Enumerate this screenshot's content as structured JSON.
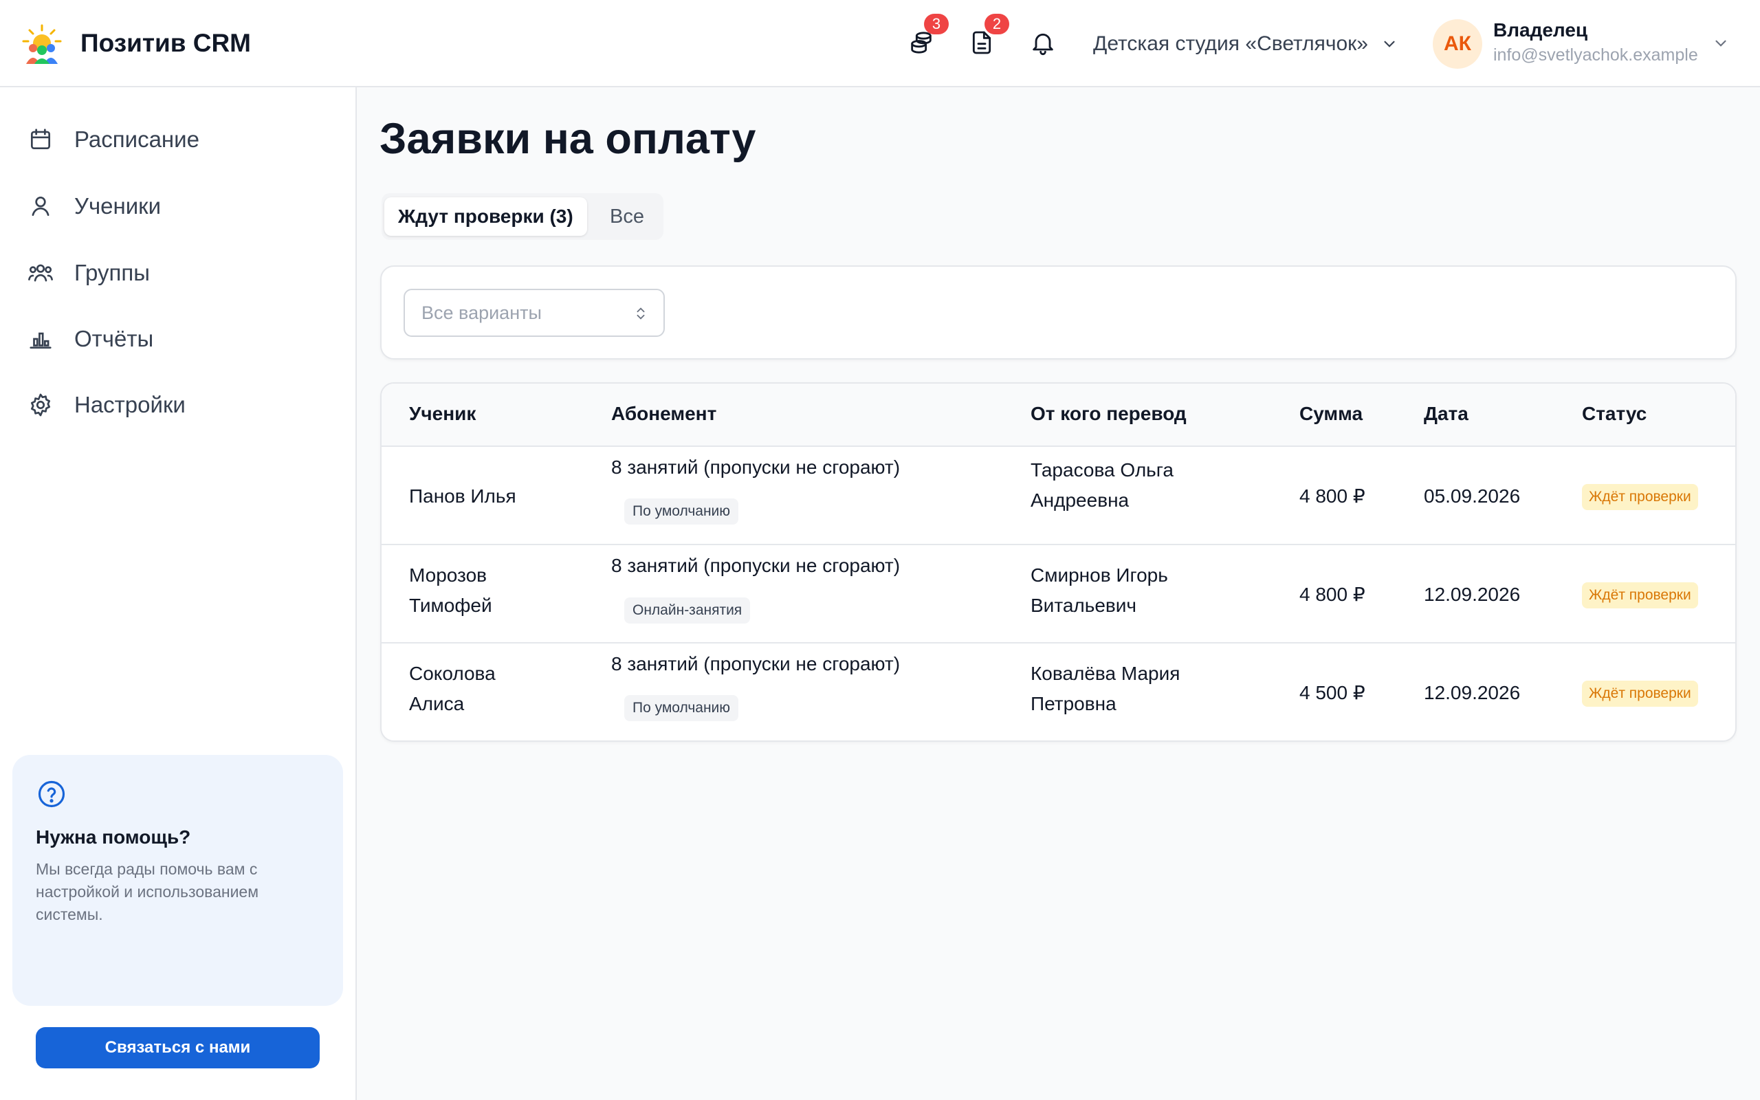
{
  "header": {
    "brand": "Позитив CRM",
    "payments_badge": "3",
    "documents_badge": "2",
    "studio": "Детская студия «Светлячок»",
    "user": {
      "initials": "АК",
      "role": "Владелец",
      "email": "info@svetlyachok.example"
    }
  },
  "sidebar": {
    "items": [
      {
        "label": "Расписание",
        "icon": "calendar-icon"
      },
      {
        "label": "Ученики",
        "icon": "user-icon"
      },
      {
        "label": "Группы",
        "icon": "users-icon"
      },
      {
        "label": "Отчёты",
        "icon": "bar-chart-icon"
      },
      {
        "label": "Настройки",
        "icon": "gear-icon"
      }
    ],
    "help": {
      "title": "Нужна помощь?",
      "text": "Мы всегда рады помочь вам с настройкой и использованием системы.",
      "button": "Связаться с нами"
    }
  },
  "main": {
    "title": "Заявки на оплату",
    "tabs": {
      "pending": "Ждут проверки (3)",
      "all": "Все"
    },
    "filter": {
      "placeholder": "Все варианты"
    },
    "table": {
      "headers": {
        "student": "Ученик",
        "subscription": "Абонемент",
        "payer": "От кого перевод",
        "amount": "Сумма",
        "date": "Дата",
        "status": "Статус"
      },
      "rows": [
        {
          "student_line1": "Панов Илья",
          "student_line2": "",
          "subscription": "8 занятий (пропуски не сгорают)",
          "tag": "По умолчанию",
          "payer_line1": "Тарасова Ольга",
          "payer_line2": "Андреевна",
          "amount": "4 800 ₽",
          "date": "05.09.2026",
          "status": "Ждёт проверки"
        },
        {
          "student_line1": "Морозов",
          "student_line2": "Тимофей",
          "subscription": "8 занятий (пропуски не сгорают)",
          "tag": "Онлайн-занятия",
          "payer_line1": "Смирнов Игорь",
          "payer_line2": "Витальевич",
          "amount": "4 800 ₽",
          "date": "12.09.2026",
          "status": "Ждёт проверки"
        },
        {
          "student_line1": "Соколова",
          "student_line2": "Алиса",
          "subscription": "8 занятий (пропуски не сгорают)",
          "tag": "По умолчанию",
          "payer_line1": "Ковалёва Мария",
          "payer_line2": "Петровна",
          "amount": "4 500 ₽",
          "date": "12.09.2026",
          "status": "Ждёт проверки"
        }
      ]
    }
  },
  "colors": {
    "accent": "#1764d8",
    "badge": "#ef4444",
    "status_bg": "#fef3c7",
    "status_text": "#d97706",
    "avatar_bg": "#ffedd5",
    "avatar_text": "#ea580c"
  }
}
